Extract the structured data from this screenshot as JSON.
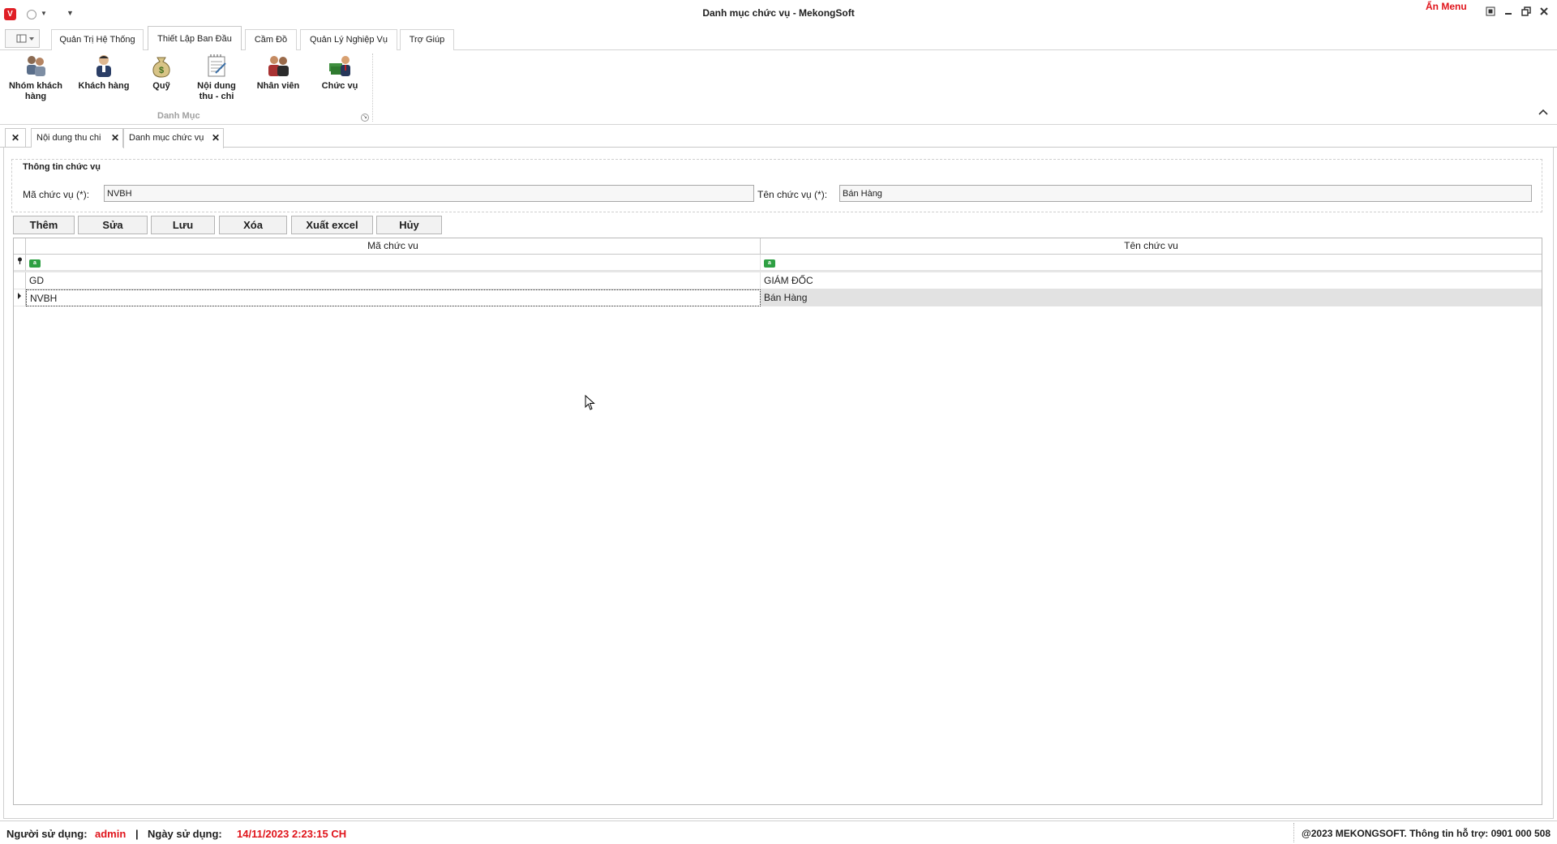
{
  "window": {
    "title": "Danh mục chức vụ - MekongSoft",
    "logo_letter": "V",
    "hide_menu_label": "Ẩn Menu"
  },
  "ribbon": {
    "tabs": [
      {
        "label": "Quản Trị Hệ Thống"
      },
      {
        "label": "Thiết Lập Ban Đầu"
      },
      {
        "label": "Cầm Đồ"
      },
      {
        "label": "Quản Lý Nghiệp Vụ"
      },
      {
        "label": "Trợ Giúp"
      }
    ],
    "buttons": [
      {
        "label": "Nhóm khách hàng",
        "icon": "customer-group-icon"
      },
      {
        "label": "Khách hàng",
        "icon": "customer-icon"
      },
      {
        "label": "Quỹ",
        "icon": "money-bag-icon"
      },
      {
        "label": "Nội dung thu - chi",
        "icon": "notepad-icon"
      },
      {
        "label": "Nhân viên",
        "icon": "staff-icon"
      },
      {
        "label": "Chức vụ",
        "icon": "position-icon"
      }
    ],
    "group_label": "Danh Mục"
  },
  "doc_tabs": [
    {
      "label": "Nội dung thu chi"
    },
    {
      "label": "Danh mục chức vụ"
    }
  ],
  "info": {
    "title": "Thông tin chức vụ",
    "code_label": "Mã chức vụ (*):",
    "code_value": "NVBH",
    "name_label": "Tên chức vụ (*):",
    "name_value": "Bán Hàng"
  },
  "actions": {
    "add": "Thêm",
    "edit": "Sửa",
    "save": "Lưu",
    "delete": "Xóa",
    "export": "Xuất excel",
    "cancel": "Hủy"
  },
  "grid": {
    "columns": [
      "Mã chức vu",
      "Tên chức vu"
    ],
    "rows": [
      {
        "code": "GD",
        "name": "GIÁM ĐỐC"
      },
      {
        "code": "NVBH",
        "name": "Bán Hàng"
      }
    ]
  },
  "status": {
    "user_label": "Người sử dụng:",
    "user_value": "admin",
    "separator": "|",
    "date_label": "Ngày sử dụng:",
    "date_value": "14/11/2023 2:23:15 CH",
    "copyright": "@2023 MEKONGSOFT. Thông tin hỗ trợ: 0901 000 508"
  },
  "colors": {
    "accent_red": "#e0141b",
    "brand_red": "#e01f26"
  }
}
